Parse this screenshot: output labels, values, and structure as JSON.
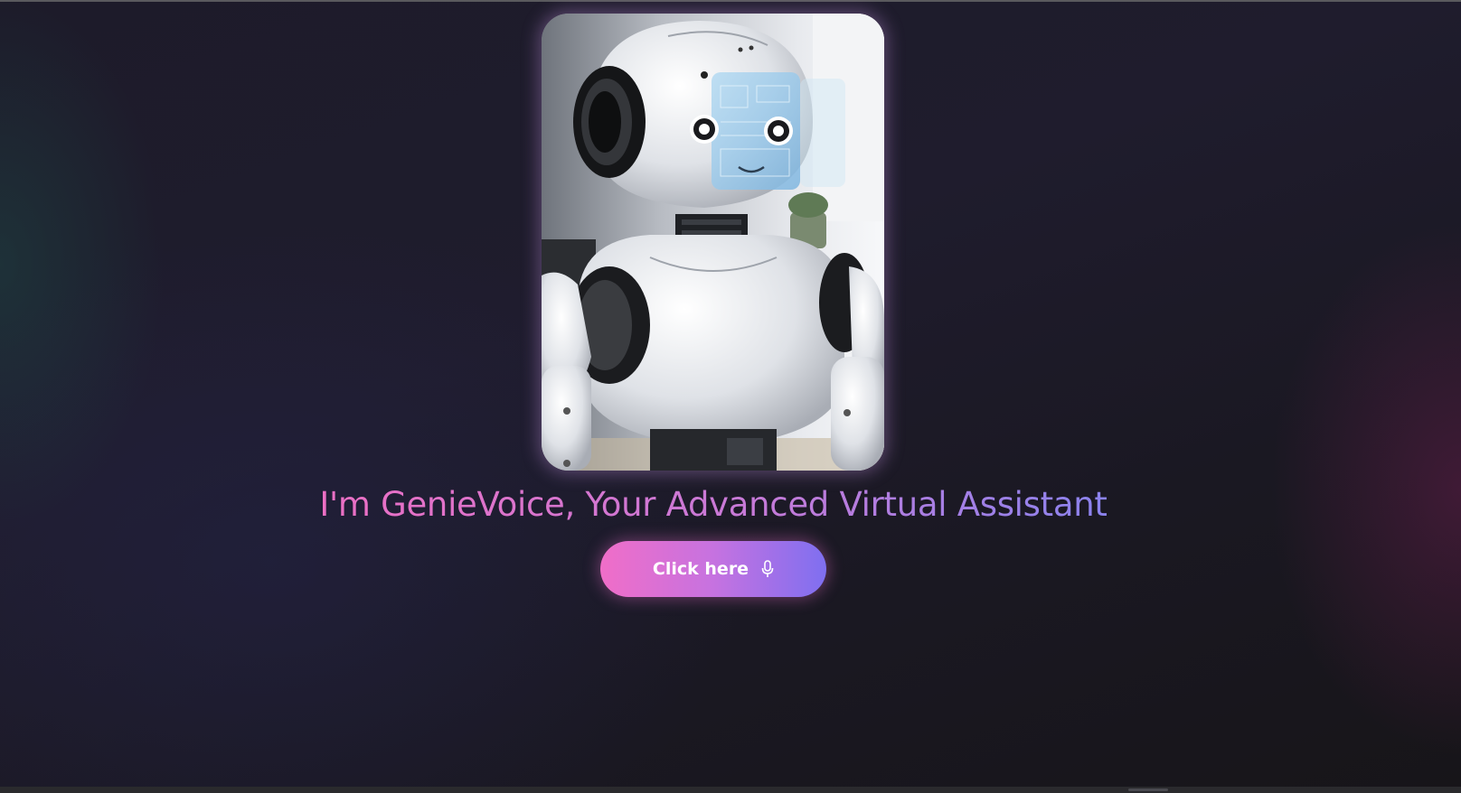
{
  "hero": {
    "image_icon": "robot-assistant-image",
    "alt": "Robot assistant"
  },
  "headline": {
    "text": "I'm GenieVoice, Your Advanced Virtual Assistant",
    "gradient_start": "#ec6fc4",
    "gradient_end": "#8b83ee"
  },
  "cta": {
    "label": "Click here",
    "icon": "microphone-icon",
    "gradient_start": "#f06ec8",
    "gradient_end": "#7f6ff0"
  },
  "colors": {
    "background": "#1c1a27",
    "accent_pink": "#f06ec8",
    "accent_violet": "#7f6ff0"
  }
}
